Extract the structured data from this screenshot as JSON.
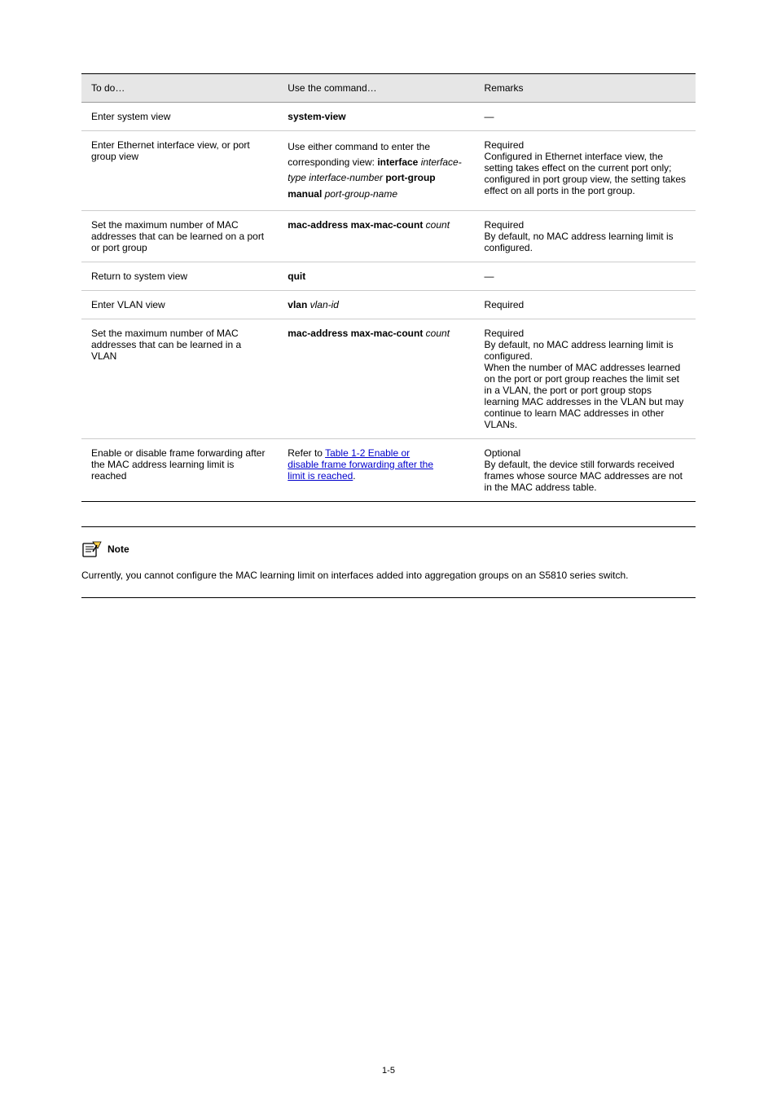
{
  "table": {
    "headers": [
      "To do…",
      "Use the command…",
      "Remarks"
    ],
    "rows": [
      {
        "c1_plain": "Enter system view",
        "c2_bold": "system-view",
        "c3": "—"
      },
      {
        "c1_plain": "Enter Ethernet interface view, or port group view",
        "c2_pre": "Use either command to enter\nthe corresponding view:\n",
        "c2_bold1": "interface ",
        "c2_italic1": "interface-type\ninterface-number\n",
        "c2_bold2": "port-group manual\n",
        "c2_italic2": "port-group-name",
        "c3": "Required\nConfigured in Ethernet interface view, the setting takes effect on the current port only; configured in port group view, the setting takes effect on all ports in the port group."
      },
      {
        "c1_plain": "Set the maximum number of MAC addresses that can be learned on a port or port group",
        "c2_bold1": "mac-address max-mac-count ",
        "c2_italic1": "count",
        "c3": "Required\nBy default, no MAC address learning limit is configured."
      },
      {
        "c1_plain": "Return to system view",
        "c2_bold": "quit",
        "c3": "—"
      },
      {
        "c1_plain": "Enter VLAN view",
        "c2_bold1": "vlan ",
        "c2_italic1": "vlan-id",
        "c3": "Required"
      },
      {
        "c1_plain": "Set the maximum number of MAC addresses that can be learned in a VLAN",
        "c2_bold1": "mac-address max-mac-count ",
        "c2_italic1": "count",
        "c3": "Required\nBy default, no MAC address learning limit is configured.\nWhen the number of MAC addresses learned on the port or port group reaches the limit set in a VLAN, the port or port group stops learning MAC addresses in the VLAN but may continue to learn MAC addresses in other VLANs."
      },
      {
        "c1_plain": "Enable or disable frame forwarding after the MAC address learning limit is reached",
        "c2_plain1": "Refer to ",
        "c2_link1": "Table 1-2 Enable or ",
        "c2_link2": "disable frame forwarding after the ",
        "c2_link3": "limit is reached",
        "c2_plain2": ".",
        "c3": "Optional\nBy default, the device still forwards received frames whose source MAC addresses are not in the MAC address table."
      }
    ]
  },
  "note": {
    "label": "Note",
    "text": "Currently, you cannot configure the MAC learning limit on interfaces added into aggregation groups on an S5810 series switch."
  },
  "pageNumber": "1-5"
}
